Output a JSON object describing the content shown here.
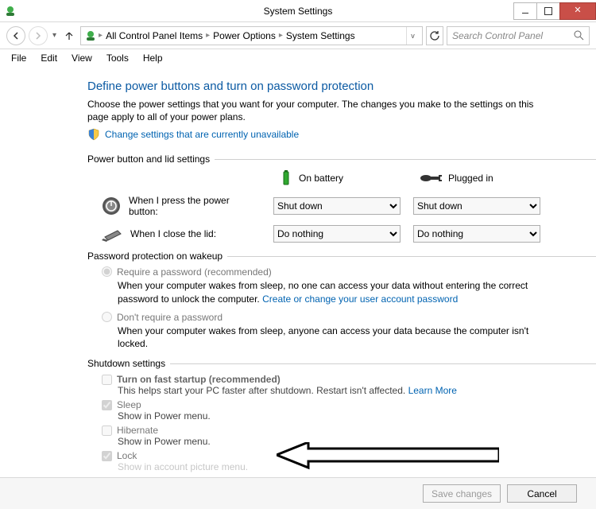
{
  "window": {
    "title": "System Settings"
  },
  "breadcrumb": {
    "part1": "All Control Panel Items",
    "part2": "Power Options",
    "part3": "System Settings"
  },
  "search": {
    "placeholder": "Search Control Panel"
  },
  "menu": {
    "file": "File",
    "edit": "Edit",
    "view": "View",
    "tools": "Tools",
    "help": "Help"
  },
  "page": {
    "heading": "Define power buttons and turn on password protection",
    "desc": "Choose the power settings that you want for your computer. The changes you make to the settings on this page apply to all of your power plans.",
    "change_link": "Change settings that are currently unavailable"
  },
  "section1": {
    "title": "Power button and lid settings",
    "on_battery": "On battery",
    "plugged_in": "Plugged in",
    "press_power": "When I press the power button:",
    "close_lid": "When I close the lid:",
    "opt_shutdown": "Shut down",
    "opt_donothing": "Do nothing"
  },
  "section2": {
    "title": "Password protection on wakeup",
    "r1_label": "Require a password (recommended)",
    "r1_text_a": "When your computer wakes from sleep, no one can access your data without entering the correct password to unlock the computer. ",
    "r1_link": "Create or change your user account password",
    "r2_label": "Don't require a password",
    "r2_text": "When your computer wakes from sleep, anyone can access your data because the computer isn't locked."
  },
  "section3": {
    "title": "Shutdown settings",
    "fast_label": "Turn on fast startup (recommended)",
    "fast_text_a": "This helps start your PC faster after shutdown. Restart isn't affected. ",
    "fast_link": "Learn More",
    "sleep_label": "Sleep",
    "sleep_text": "Show in Power menu.",
    "hib_label": "Hibernate",
    "hib_text": "Show in Power menu.",
    "lock_label": "Lock",
    "lock_text": "Show in account picture menu."
  },
  "footer": {
    "save": "Save changes",
    "cancel": "Cancel"
  }
}
